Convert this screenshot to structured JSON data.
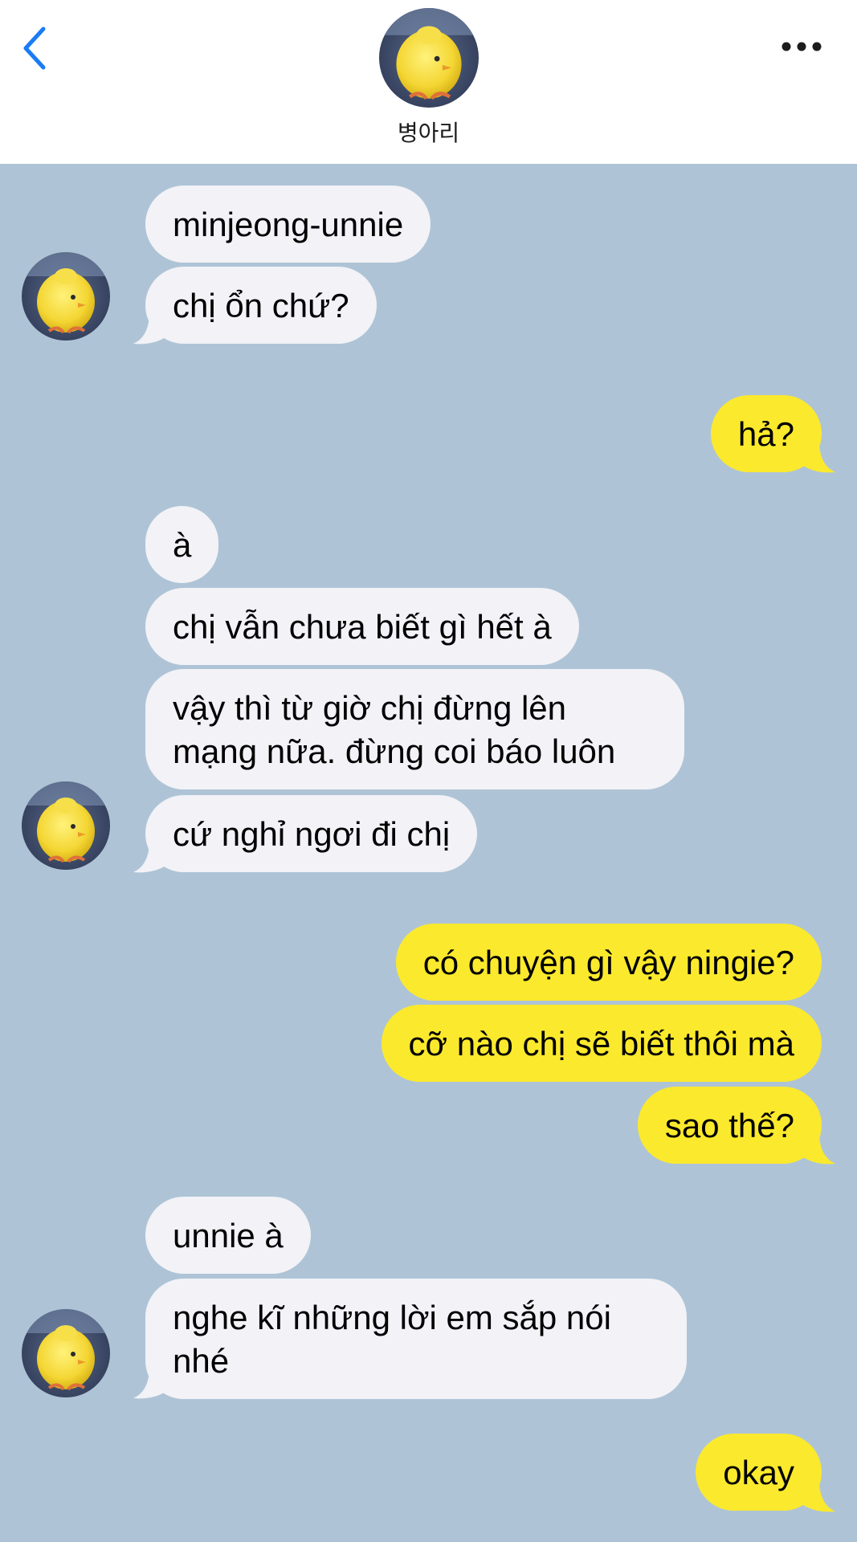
{
  "header": {
    "contact_name": "병아리",
    "back_icon": "chevron-left-icon",
    "more_icon": "ellipsis-icon",
    "accent_color": "#1a7cf5"
  },
  "chat": {
    "background_color": "#aec4d6",
    "incoming_bubble_color": "#f2f2f7",
    "outgoing_bubble_color": "#fbe92d",
    "messages": [
      {
        "sender": "them",
        "text": "minjeong-unnie"
      },
      {
        "sender": "them",
        "text": "chị ổn chứ?"
      },
      {
        "sender": "me",
        "text": "hả?"
      },
      {
        "sender": "them",
        "text": "à"
      },
      {
        "sender": "them",
        "text": "chị vẫn chưa biết gì hết à"
      },
      {
        "sender": "them",
        "text": "vậy thì từ giờ chị đừng lên mạng nữa. đừng coi báo luôn"
      },
      {
        "sender": "them",
        "text": "cứ nghỉ ngơi đi chị"
      },
      {
        "sender": "me",
        "text": "có chuyện gì vậy ningie?"
      },
      {
        "sender": "me",
        "text": "cỡ nào chị sẽ biết thôi mà"
      },
      {
        "sender": "me",
        "text": "sao thế?"
      },
      {
        "sender": "them",
        "text": "unnie à"
      },
      {
        "sender": "them",
        "text": "nghe kĩ những lời em sắp nói nhé"
      },
      {
        "sender": "me",
        "text": "okay"
      }
    ]
  }
}
